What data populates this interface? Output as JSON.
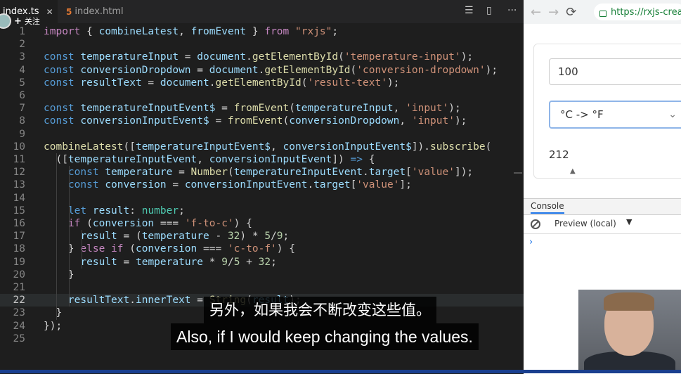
{
  "editor": {
    "tabs": [
      {
        "label": "index.ts",
        "close": "✕"
      },
      {
        "label": "index.html",
        "icon": "html5-icon"
      }
    ],
    "actions": {
      "split": "☰",
      "layout": "▯",
      "more": "···"
    },
    "follow": {
      "plus": "+",
      "label": "关注"
    },
    "current_line": 22,
    "lines": [
      [
        [
          "kwc",
          "import"
        ],
        [
          "pn",
          " { "
        ],
        [
          "var",
          "combineLatest"
        ],
        [
          "pn",
          ", "
        ],
        [
          "var",
          "fromEvent"
        ],
        [
          "pn",
          " } "
        ],
        [
          "kwc",
          "from"
        ],
        [
          "pn",
          " "
        ],
        [
          "str",
          "\"rxjs\""
        ],
        [
          "pn",
          ";"
        ]
      ],
      [],
      [
        [
          "kw",
          "const"
        ],
        [
          "pn",
          " "
        ],
        [
          "var",
          "temperatureInput"
        ],
        [
          "pn",
          " = "
        ],
        [
          "var",
          "document"
        ],
        [
          "pn",
          "."
        ],
        [
          "fn",
          "getElementById"
        ],
        [
          "pn",
          "("
        ],
        [
          "str",
          "'temperature-input'"
        ],
        [
          "pn",
          ");"
        ]
      ],
      [
        [
          "kw",
          "const"
        ],
        [
          "pn",
          " "
        ],
        [
          "var",
          "conversionDropdown"
        ],
        [
          "pn",
          " = "
        ],
        [
          "var",
          "document"
        ],
        [
          "pn",
          "."
        ],
        [
          "fn",
          "getElementById"
        ],
        [
          "pn",
          "("
        ],
        [
          "str",
          "'conversion-dropdown'"
        ],
        [
          "pn",
          ");"
        ]
      ],
      [
        [
          "kw",
          "const"
        ],
        [
          "pn",
          " "
        ],
        [
          "var",
          "resultText"
        ],
        [
          "pn",
          " = "
        ],
        [
          "var",
          "document"
        ],
        [
          "pn",
          "."
        ],
        [
          "fn",
          "getElementById"
        ],
        [
          "pn",
          "("
        ],
        [
          "str",
          "'result-text'"
        ],
        [
          "pn",
          ");"
        ]
      ],
      [],
      [
        [
          "kw",
          "const"
        ],
        [
          "pn",
          " "
        ],
        [
          "var",
          "temperatureInputEvent$"
        ],
        [
          "pn",
          " = "
        ],
        [
          "fn",
          "fromEvent"
        ],
        [
          "pn",
          "("
        ],
        [
          "var",
          "temperatureInput"
        ],
        [
          "pn",
          ", "
        ],
        [
          "str",
          "'input'"
        ],
        [
          "pn",
          ");"
        ]
      ],
      [
        [
          "kw",
          "const"
        ],
        [
          "pn",
          " "
        ],
        [
          "var",
          "conversionInputEvent$"
        ],
        [
          "pn",
          " = "
        ],
        [
          "fn",
          "fromEvent"
        ],
        [
          "pn",
          "("
        ],
        [
          "var",
          "conversionDropdown"
        ],
        [
          "pn",
          ", "
        ],
        [
          "str",
          "'input'"
        ],
        [
          "pn",
          ");"
        ]
      ],
      [],
      [
        [
          "fn",
          "combineLatest"
        ],
        [
          "pn",
          "(["
        ],
        [
          "var",
          "temperatureInputEvent$"
        ],
        [
          "pn",
          ", "
        ],
        [
          "var",
          "conversionInputEvent$"
        ],
        [
          "pn",
          "])."
        ],
        [
          "fn",
          "subscribe"
        ],
        [
          "pn",
          "("
        ]
      ],
      [
        [
          "pn",
          "  (["
        ],
        [
          "var",
          "temperatureInputEvent"
        ],
        [
          "pn",
          ", "
        ],
        [
          "var",
          "conversionInputEvent"
        ],
        [
          "pn",
          "]) "
        ],
        [
          "kw",
          "=>"
        ],
        [
          "pn",
          " {"
        ]
      ],
      [
        [
          "pn",
          "    "
        ],
        [
          "kw",
          "const"
        ],
        [
          "pn",
          " "
        ],
        [
          "var",
          "temperature"
        ],
        [
          "pn",
          " = "
        ],
        [
          "fn",
          "Number"
        ],
        [
          "pn",
          "("
        ],
        [
          "var",
          "temperatureInputEvent"
        ],
        [
          "pn",
          "."
        ],
        [
          "var",
          "target"
        ],
        [
          "pn",
          "["
        ],
        [
          "str",
          "'value'"
        ],
        [
          "pn",
          "]);"
        ]
      ],
      [
        [
          "pn",
          "    "
        ],
        [
          "kw",
          "const"
        ],
        [
          "pn",
          " "
        ],
        [
          "var",
          "conversion"
        ],
        [
          "pn",
          " = "
        ],
        [
          "var",
          "conversionInputEvent"
        ],
        [
          "pn",
          "."
        ],
        [
          "var",
          "target"
        ],
        [
          "pn",
          "["
        ],
        [
          "str",
          "'value'"
        ],
        [
          "pn",
          "];"
        ]
      ],
      [],
      [
        [
          "pn",
          "    "
        ],
        [
          "kw",
          "let"
        ],
        [
          "pn",
          " "
        ],
        [
          "var",
          "result"
        ],
        [
          "pn",
          ": "
        ],
        [
          "typ",
          "number"
        ],
        [
          "pn",
          ";"
        ]
      ],
      [
        [
          "pn",
          "    "
        ],
        [
          "kwc",
          "if"
        ],
        [
          "pn",
          " ("
        ],
        [
          "var",
          "conversion"
        ],
        [
          "pn",
          " === "
        ],
        [
          "str",
          "'f-to-c'"
        ],
        [
          "pn",
          ") {"
        ]
      ],
      [
        [
          "pn",
          "      "
        ],
        [
          "var",
          "result"
        ],
        [
          "pn",
          " = ("
        ],
        [
          "var",
          "temperature"
        ],
        [
          "pn",
          " - "
        ],
        [
          "num",
          "32"
        ],
        [
          "pn",
          ") * "
        ],
        [
          "num",
          "5"
        ],
        [
          "pn",
          "/"
        ],
        [
          "num",
          "9"
        ],
        [
          "pn",
          ";"
        ]
      ],
      [
        [
          "pn",
          "    } "
        ],
        [
          "kwc",
          "else if"
        ],
        [
          "pn",
          " ("
        ],
        [
          "var",
          "conversion"
        ],
        [
          "pn",
          " === "
        ],
        [
          "str",
          "'c-to-f'"
        ],
        [
          "pn",
          ") {"
        ]
      ],
      [
        [
          "pn",
          "      "
        ],
        [
          "var",
          "result"
        ],
        [
          "pn",
          " = "
        ],
        [
          "var",
          "temperature"
        ],
        [
          "pn",
          " * "
        ],
        [
          "num",
          "9"
        ],
        [
          "pn",
          "/"
        ],
        [
          "num",
          "5"
        ],
        [
          "pn",
          " + "
        ],
        [
          "num",
          "32"
        ],
        [
          "pn",
          ";"
        ]
      ],
      [
        [
          "pn",
          "    }"
        ]
      ],
      [],
      [
        [
          "pn",
          "    "
        ],
        [
          "var",
          "resultText"
        ],
        [
          "pn",
          "."
        ],
        [
          "var",
          "innerText"
        ],
        [
          "pn",
          " = "
        ],
        [
          "fn",
          "String"
        ],
        [
          "pn",
          "("
        ],
        [
          "var",
          "result"
        ],
        [
          "pn",
          ");"
        ]
      ],
      [
        [
          "pn",
          "  }"
        ]
      ],
      [
        [
          "pn",
          "});"
        ]
      ],
      []
    ]
  },
  "subtitle": {
    "chinese": "另外，如果我会不断改变这些值。",
    "english": "Also, if I would keep changing the values."
  },
  "browser": {
    "url": "https://rxjs-crea",
    "nav_icons": [
      "←",
      "→",
      "⟳"
    ],
    "temperature_value": "100",
    "conversion_selected": "°C -> °F",
    "result": "212",
    "devtools": {
      "tab": "Console",
      "context": "Preview (local)",
      "context_arrow": "▼",
      "prompt": "›"
    }
  }
}
